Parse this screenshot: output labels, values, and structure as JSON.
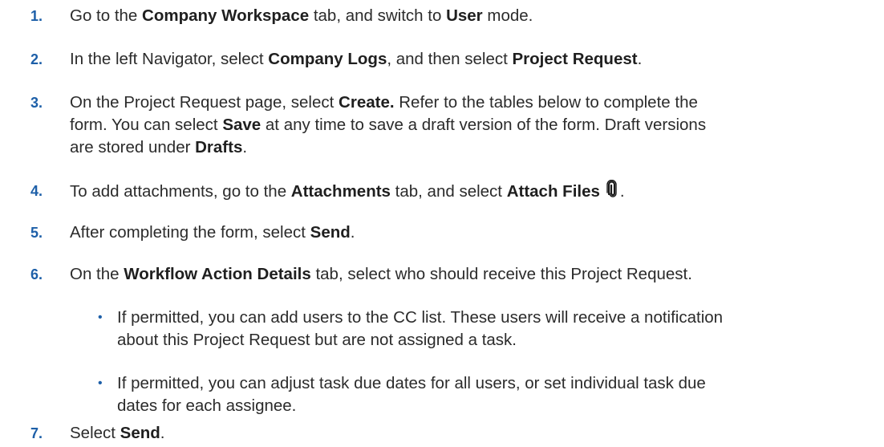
{
  "steps": [
    {
      "number": "1.",
      "parts": [
        "Go to the ",
        "Company Workspace",
        " tab, and switch to ",
        "User",
        " mode."
      ]
    },
    {
      "number": "2.",
      "parts": [
        "In the left Navigator, select ",
        "Company Logs",
        ", and then select ",
        "Project Request",
        "."
      ]
    },
    {
      "number": "3.",
      "line1": [
        "On the Project Request page, select ",
        "Create.",
        " Refer to the tables below to complete the"
      ],
      "line2": [
        "form. You can select ",
        "Save",
        " at any time to save a draft version of the form. Draft versions"
      ],
      "line3": [
        "are stored under ",
        "Drafts",
        "."
      ]
    },
    {
      "number": "4.",
      "parts": [
        "To add attachments, go to the ",
        "Attachments",
        " tab, and select ",
        "Attach Files",
        "."
      ],
      "icon": "paperclip-icon"
    },
    {
      "number": "5.",
      "parts": [
        "After completing the form, select ",
        "Send",
        "."
      ]
    },
    {
      "number": "6.",
      "parts": [
        "On the ",
        "Workflow Action Details",
        " tab, select who should receive this Project Request."
      ],
      "bullets": [
        {
          "line1": "If permitted, you can add users to the CC list. These users will receive a notification",
          "line2": "about this Project Request but are not assigned a task."
        },
        {
          "line1": "If permitted, you can adjust task due dates for all users, or set individual task due",
          "line2": "dates for each assignee."
        }
      ]
    },
    {
      "number": "7.",
      "parts": [
        "Select ",
        "Send",
        "."
      ]
    }
  ],
  "colors": {
    "number": "#1d5fa8",
    "text": "#2b2b2b"
  }
}
